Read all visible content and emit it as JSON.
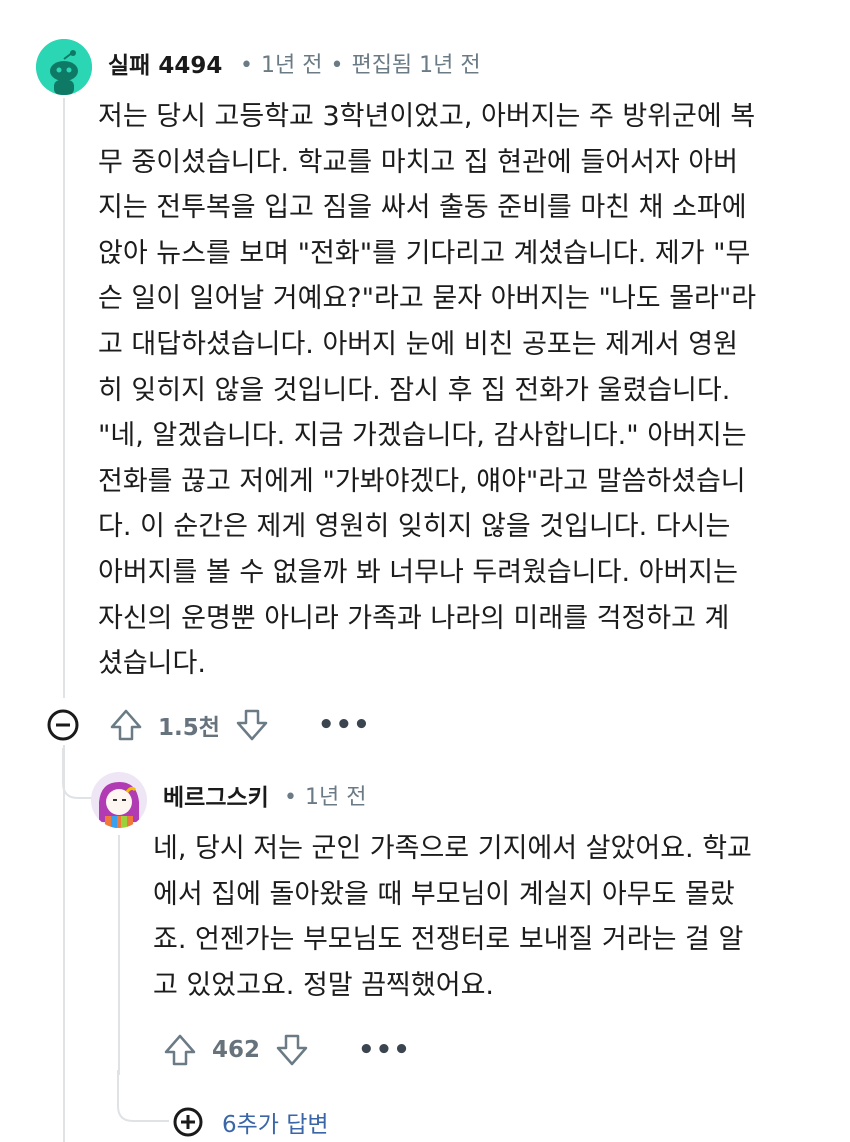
{
  "comment": {
    "author": "실패 4494",
    "time": "1년 전",
    "edited": "편집됨 1년 전",
    "body_lines": [
      "저는 당시 고등학교 3학년이었고, 아버지는 주 방위군에 복",
      "무 중이셨습니다. 학교를 마치고 집 현관에 들어서자 아버",
      "지는 전투복을 입고 짐을 싸서 출동 준비를 마친 채 소파에",
      "앉아 뉴스를 보며 \"전화\"를 기다리고 계셨습니다. 제가 \"무",
      "슨 일이 일어날 거예요?\"라고 묻자 아버지는 \"나도 몰라\"라",
      "고 대답하셨습니다. 아버지 눈에 비친 공포는 제게서 영원",
      "히 잊히지 않을 것입니다. 잠시 후 집 전화가 울렸습니다.",
      "\"네, 알겠습니다. 지금 가겠습니다, 감사합니다.\" 아버지는",
      "전화를 끊고 저에게 \"가봐야겠다, 얘야\"라고 말씀하셨습니",
      "다. 이 순간은 제게 영원히 잊히지 않을 것입니다. 다시는",
      "아버지를 볼 수 없을까 봐 너무나 두려웠습니다. 아버지는",
      "자신의 운명뿐 아니라 가족과 나라의 미래를 걱정하고 계",
      "셨습니다."
    ],
    "votes": "1.5천",
    "more": "•••"
  },
  "reply": {
    "author": "베르그스키",
    "time": "1년 전",
    "body_lines": [
      "네, 당시 저는 군인 가족으로 기지에서 살았어요. 학교",
      "에서 집에 돌아왔을 때 부모님이 계실지 아무도 몰랐",
      "죠. 언젠가는 부모님도 전쟁터로 보내질 거라는 걸 알",
      "고 있었고요. 정말 끔찍했어요."
    ],
    "votes": "462",
    "more": "•••"
  },
  "more_replies": "6추가 답변",
  "separator": "•",
  "colors": {
    "avatar1_bg": "#2bd6b4",
    "link": "#3a66a8",
    "muted": "#6b7b86"
  }
}
